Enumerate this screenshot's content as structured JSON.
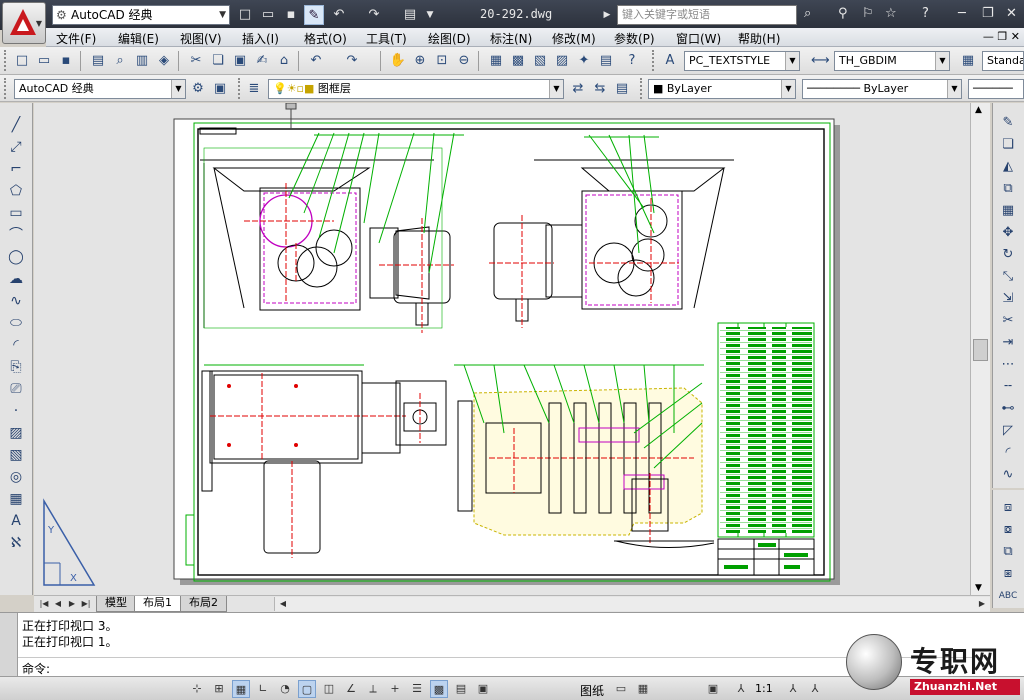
{
  "titlebar": {
    "workspace": "AutoCAD 经典",
    "document_title": "20-292.dwg",
    "search_placeholder": "键入关键字或短语"
  },
  "menubar": {
    "items": [
      "文件(F)",
      "编辑(E)",
      "视图(V)",
      "插入(I)",
      "格式(O)",
      "工具(T)",
      "绘图(D)",
      "标注(N)",
      "修改(M)",
      "参数(P)",
      "窗口(W)",
      "帮助(H)"
    ]
  },
  "toolbar1": {
    "text_style": "PC_TEXTSTYLE",
    "dim_style": "TH_GBDIM",
    "table_style": "Standa"
  },
  "toolbar2": {
    "workspace": "AutoCAD 经典",
    "layer": "图框层",
    "color": "ByLayer",
    "linetype": "ByLayer"
  },
  "layout_tabs": {
    "items": [
      "模型",
      "布局1",
      "布局2"
    ],
    "active_index": 1
  },
  "command": {
    "history": [
      "正在打印视口 3。",
      "正在打印视口 1。"
    ],
    "prompt": "命令:"
  },
  "statusbar": {
    "paper_label": "图纸",
    "scale": "1:1"
  },
  "watermark": {
    "title": "专职网",
    "url": "Zhuanzhi.Net"
  },
  "colors": {
    "drawing_green": "#00b000",
    "drawing_red": "#e00000",
    "drawing_magenta": "#c000c0",
    "drawing_yellow": "#c8b400",
    "paper": "#ffffff",
    "workspace_bg": "#e4e4e4"
  }
}
